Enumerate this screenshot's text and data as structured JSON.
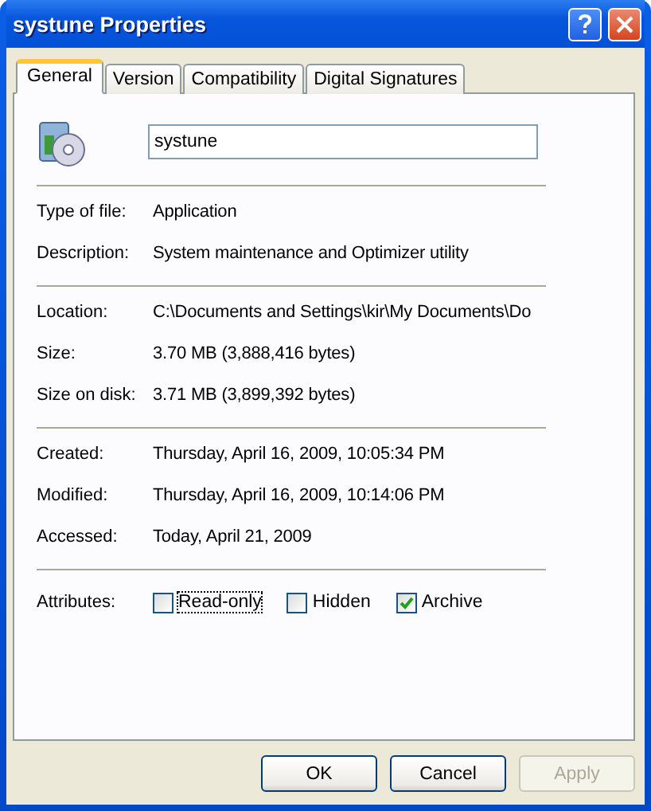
{
  "window": {
    "title": "systune Properties"
  },
  "tabs": [
    {
      "label": "General",
      "selected": true
    },
    {
      "label": "Version",
      "selected": false
    },
    {
      "label": "Compatibility",
      "selected": false
    },
    {
      "label": "Digital Signatures",
      "selected": false
    }
  ],
  "name_field": {
    "value": "systune"
  },
  "groups": [
    [
      {
        "label": "Type of file:",
        "value": "Application"
      },
      {
        "label": "Description:",
        "value": "System maintenance and Optimizer utility"
      }
    ],
    [
      {
        "label": "Location:",
        "value": "C:\\Documents and Settings\\kir\\My Documents\\Do"
      },
      {
        "label": "Size:",
        "value": "3.70 MB (3,888,416 bytes)"
      },
      {
        "label": "Size on disk:",
        "value": "3.71 MB (3,899,392 bytes)"
      }
    ],
    [
      {
        "label": "Created:",
        "value": "Thursday, April 16, 2009, 10:05:34 PM"
      },
      {
        "label": "Modified:",
        "value": "Thursday, April 16, 2009, 10:14:06 PM"
      },
      {
        "label": "Accessed:",
        "value": "Today, April 21, 2009"
      }
    ]
  ],
  "attributes": {
    "label": "Attributes:",
    "items": [
      {
        "label": "Read-only",
        "checked": false,
        "focused": true
      },
      {
        "label": "Hidden",
        "checked": false,
        "focused": false
      },
      {
        "label": "Archive",
        "checked": true,
        "focused": false
      }
    ]
  },
  "buttons": [
    {
      "label": "OK",
      "disabled": false
    },
    {
      "label": "Cancel",
      "disabled": false
    },
    {
      "label": "Apply",
      "disabled": true
    }
  ]
}
